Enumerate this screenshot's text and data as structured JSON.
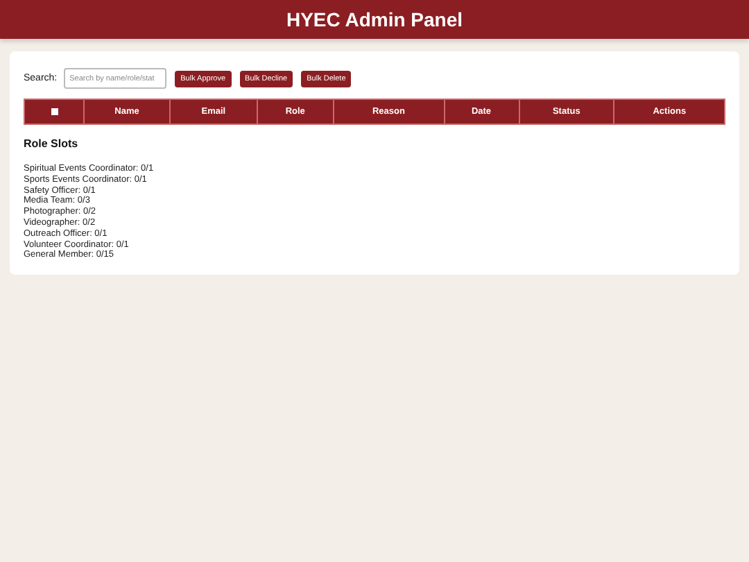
{
  "header": {
    "title": "HYEC Admin Panel"
  },
  "toolbar": {
    "search_label": "Search:",
    "search": {
      "placeholder": "Search by name/role/stat"
    },
    "buttons": [
      "Bulk Approve",
      "Bulk Decline",
      "Bulk Delete"
    ]
  },
  "table": {
    "select_all": {
      "checked": false
    },
    "columns": [
      "Name",
      "Email",
      "Role",
      "Reason",
      "Date",
      "Status",
      "Actions"
    ]
  },
  "role_slots": {
    "title": "Role Slots",
    "items": [
      "Spiritual Events Coordinator: 0/1",
      "Sports Events Coordinator: 0/1",
      "Safety Officer: 0/1",
      "Media Team: 0/3",
      "Photographer: 0/2",
      "Videographer: 0/2",
      "Outreach Officer: 0/1",
      "Volunteer Coordinator: 0/1",
      "General Member: 0/15"
    ]
  }
}
